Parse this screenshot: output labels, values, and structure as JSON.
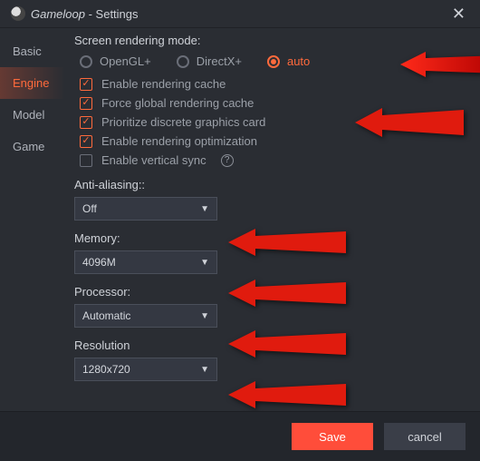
{
  "window": {
    "app_name": "Gameloop",
    "suffix": " - Settings"
  },
  "sidebar": {
    "items": [
      {
        "label": "Basic"
      },
      {
        "label": "Engine"
      },
      {
        "label": "Model"
      },
      {
        "label": "Game"
      }
    ],
    "active_index": 1
  },
  "engine": {
    "render_mode_label": "Screen rendering mode:",
    "radios": {
      "opengl": "OpenGL+",
      "directx": "DirectX+",
      "auto": "auto",
      "selected": "auto"
    },
    "checks": {
      "rendering_cache": {
        "label": "Enable rendering cache",
        "checked": true
      },
      "global_cache": {
        "label": "Force global rendering cache",
        "checked": true
      },
      "discrete_gpu": {
        "label": "Prioritize discrete graphics card",
        "checked": true
      },
      "render_opt": {
        "label": "Enable rendering optimization",
        "checked": true
      },
      "vsync": {
        "label": "Enable vertical sync",
        "checked": false
      }
    },
    "anti_aliasing": {
      "label": "Anti-aliasing::",
      "value": "Off"
    },
    "memory": {
      "label": "Memory:",
      "value": "4096M"
    },
    "processor": {
      "label": "Processor:",
      "value": "Automatic"
    },
    "resolution": {
      "label": "Resolution",
      "value": "1280x720"
    }
  },
  "footer": {
    "save": "Save",
    "cancel": "cancel"
  }
}
